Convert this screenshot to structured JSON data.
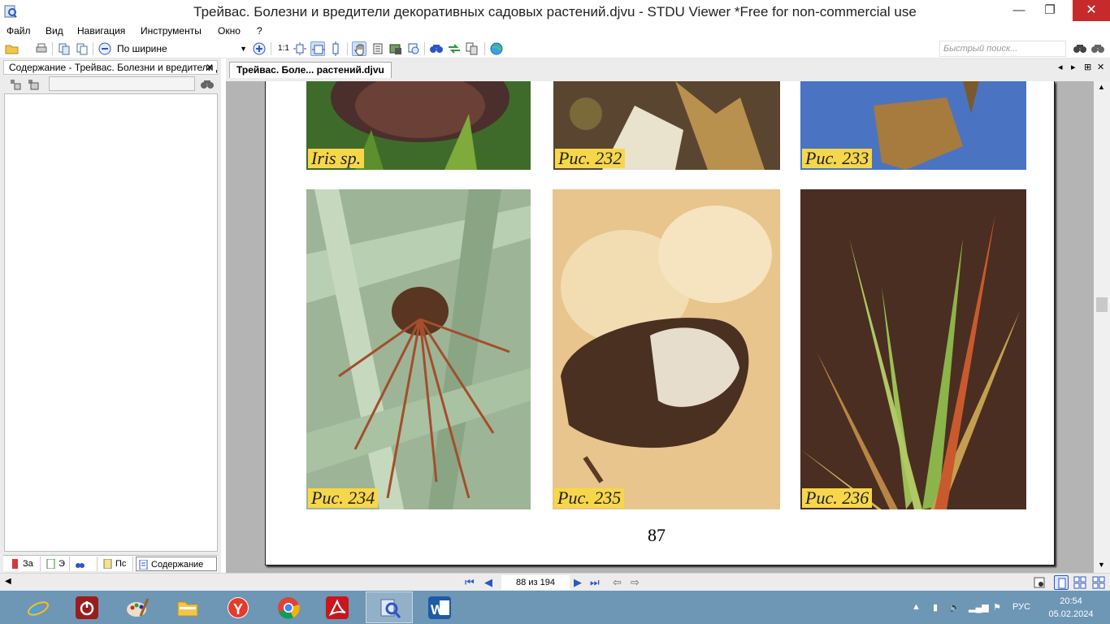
{
  "window": {
    "title": "Трейвас. Болезни и вредители декоративных садовых растений.djvu - STDU Viewer *Free for non-commercial use",
    "minimize": "—",
    "maximize": "❐",
    "close": "✕"
  },
  "menu": [
    "Файл",
    "Вид",
    "Навигация",
    "Инструменты",
    "Окно",
    "?"
  ],
  "toolbar": {
    "zoom_value": "По ширине",
    "actual_size": "1:1",
    "quick_search_placeholder": "Быстрый поиск..."
  },
  "sidebar": {
    "header": "Содержание - Трейвас. Болезни и вредители декоративных садовых растений.djvu",
    "tabs": [
      "За",
      "Э",
      "",
      "Пс",
      "Содержание"
    ]
  },
  "document": {
    "tab_label": "Трейвас. Боле... растений.djvu",
    "captions": [
      "Iris sp.",
      "Рис. 232",
      "Рис. 233",
      "Рис. 234",
      "Рис. 235",
      "Рис. 236"
    ],
    "page_number": "87"
  },
  "status": {
    "page_indicator": "88 из 194"
  },
  "taskbar": {
    "lang": "РУС",
    "time": "20:54",
    "date": "05.02.2024"
  }
}
